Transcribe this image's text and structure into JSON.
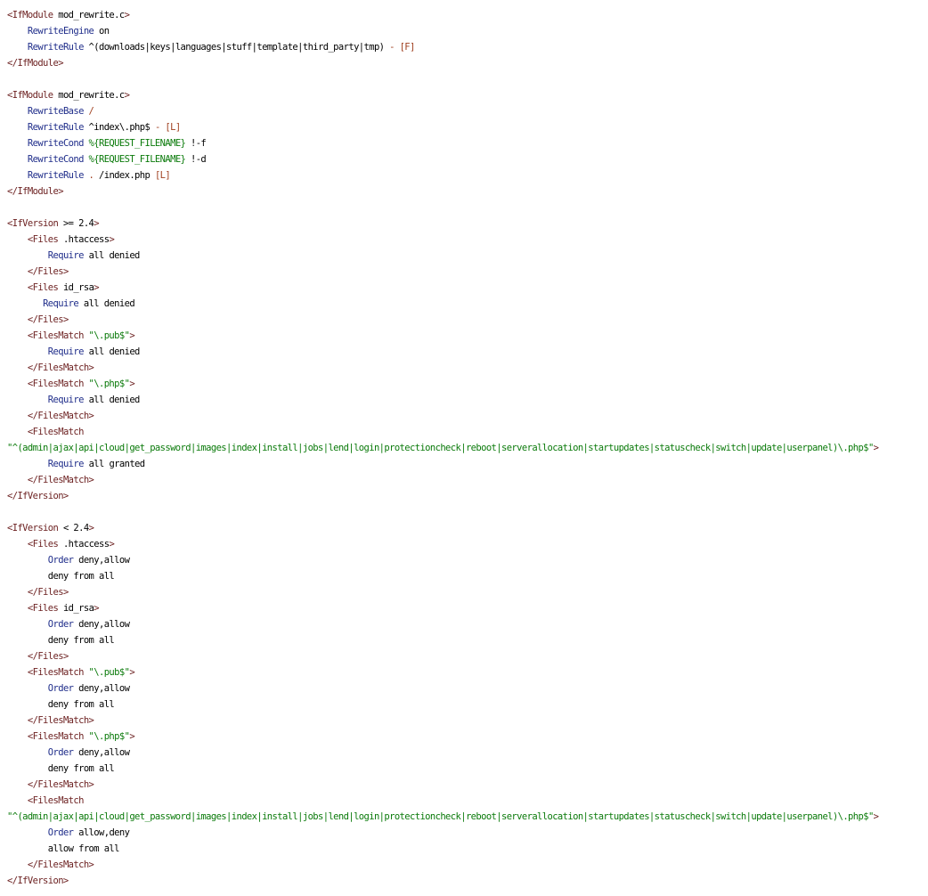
{
  "file": {
    "lines": [
      [
        {
          "c": "tag",
          "t": "<IfModule"
        },
        {
          "c": "txt",
          "t": " mod_rewrite.c"
        },
        {
          "c": "tag",
          "t": ">"
        }
      ],
      [
        {
          "c": "txt",
          "t": "    "
        },
        {
          "c": "kw",
          "t": "RewriteEngine"
        },
        {
          "c": "txt",
          "t": " on"
        }
      ],
      [
        {
          "c": "txt",
          "t": "    "
        },
        {
          "c": "kw",
          "t": "RewriteRule"
        },
        {
          "c": "txt",
          "t": " ^(downloads|keys|languages|stuff|template|third_party|tmp) "
        },
        {
          "c": "op",
          "t": "- [F]"
        }
      ],
      [
        {
          "c": "tag",
          "t": "</IfModule>"
        }
      ],
      [],
      [
        {
          "c": "tag",
          "t": "<IfModule"
        },
        {
          "c": "txt",
          "t": " mod_rewrite.c"
        },
        {
          "c": "tag",
          "t": ">"
        }
      ],
      [
        {
          "c": "txt",
          "t": "    "
        },
        {
          "c": "kw",
          "t": "RewriteBase"
        },
        {
          "c": "op",
          "t": " /"
        }
      ],
      [
        {
          "c": "txt",
          "t": "    "
        },
        {
          "c": "kw",
          "t": "RewriteRule"
        },
        {
          "c": "txt",
          "t": " ^index\\.php$ "
        },
        {
          "c": "op",
          "t": "- [L]"
        }
      ],
      [
        {
          "c": "txt",
          "t": "    "
        },
        {
          "c": "kw",
          "t": "RewriteCond"
        },
        {
          "c": "str",
          "t": " %{REQUEST_FILENAME}"
        },
        {
          "c": "txt",
          "t": " !-f"
        }
      ],
      [
        {
          "c": "txt",
          "t": "    "
        },
        {
          "c": "kw",
          "t": "RewriteCond"
        },
        {
          "c": "str",
          "t": " %{REQUEST_FILENAME}"
        },
        {
          "c": "txt",
          "t": " !-d"
        }
      ],
      [
        {
          "c": "txt",
          "t": "    "
        },
        {
          "c": "kw",
          "t": "RewriteRule"
        },
        {
          "c": "op",
          "t": " ."
        },
        {
          "c": "txt",
          "t": " /index.php "
        },
        {
          "c": "op",
          "t": "[L]"
        }
      ],
      [
        {
          "c": "tag",
          "t": "</IfModule>"
        }
      ],
      [],
      [
        {
          "c": "tag",
          "t": "<IfVersion"
        },
        {
          "c": "txt",
          "t": " >= 2.4"
        },
        {
          "c": "tag",
          "t": ">"
        }
      ],
      [
        {
          "c": "txt",
          "t": "    "
        },
        {
          "c": "tag",
          "t": "<Files"
        },
        {
          "c": "txt",
          "t": " .htaccess"
        },
        {
          "c": "tag",
          "t": ">"
        }
      ],
      [
        {
          "c": "txt",
          "t": "        "
        },
        {
          "c": "kw",
          "t": "Require"
        },
        {
          "c": "txt",
          "t": " all denied"
        }
      ],
      [
        {
          "c": "txt",
          "t": "    "
        },
        {
          "c": "tag",
          "t": "</Files>"
        }
      ],
      [
        {
          "c": "txt",
          "t": "    "
        },
        {
          "c": "tag",
          "t": "<Files"
        },
        {
          "c": "txt",
          "t": " id_rsa"
        },
        {
          "c": "tag",
          "t": ">"
        }
      ],
      [
        {
          "c": "txt",
          "t": "       "
        },
        {
          "c": "kw",
          "t": "Require"
        },
        {
          "c": "txt",
          "t": " all denied"
        }
      ],
      [
        {
          "c": "txt",
          "t": "    "
        },
        {
          "c": "tag",
          "t": "</Files>"
        }
      ],
      [
        {
          "c": "txt",
          "t": "    "
        },
        {
          "c": "tag",
          "t": "<FilesMatch"
        },
        {
          "c": "str",
          "t": " \"\\.pub$\""
        },
        {
          "c": "tag",
          "t": ">"
        }
      ],
      [
        {
          "c": "txt",
          "t": "        "
        },
        {
          "c": "kw",
          "t": "Require"
        },
        {
          "c": "txt",
          "t": " all denied"
        }
      ],
      [
        {
          "c": "txt",
          "t": "    "
        },
        {
          "c": "tag",
          "t": "</FilesMatch>"
        }
      ],
      [
        {
          "c": "txt",
          "t": "    "
        },
        {
          "c": "tag",
          "t": "<FilesMatch"
        },
        {
          "c": "str",
          "t": " \"\\.php$\""
        },
        {
          "c": "tag",
          "t": ">"
        }
      ],
      [
        {
          "c": "txt",
          "t": "        "
        },
        {
          "c": "kw",
          "t": "Require"
        },
        {
          "c": "txt",
          "t": " all denied"
        }
      ],
      [
        {
          "c": "txt",
          "t": "    "
        },
        {
          "c": "tag",
          "t": "</FilesMatch>"
        }
      ],
      [
        {
          "c": "txt",
          "t": "    "
        },
        {
          "c": "tag",
          "t": "<FilesMatch"
        }
      ],
      [
        {
          "c": "str",
          "t": "\"^(admin|ajax|api|cloud|get_password|images|index|install|jobs|lend|login|protectioncheck|reboot|serverallocation|startupdates|statuscheck|switch|update|userpanel)\\.php$\""
        },
        {
          "c": "tag",
          "t": ">"
        }
      ],
      [
        {
          "c": "txt",
          "t": "        "
        },
        {
          "c": "kw",
          "t": "Require"
        },
        {
          "c": "txt",
          "t": " all granted"
        }
      ],
      [
        {
          "c": "txt",
          "t": "    "
        },
        {
          "c": "tag",
          "t": "</FilesMatch>"
        }
      ],
      [
        {
          "c": "tag",
          "t": "</IfVersion>"
        }
      ],
      [],
      [
        {
          "c": "tag",
          "t": "<IfVersion"
        },
        {
          "c": "txt",
          "t": " < 2.4"
        },
        {
          "c": "tag",
          "t": ">"
        }
      ],
      [
        {
          "c": "txt",
          "t": "    "
        },
        {
          "c": "tag",
          "t": "<Files"
        },
        {
          "c": "txt",
          "t": " .htaccess"
        },
        {
          "c": "tag",
          "t": ">"
        }
      ],
      [
        {
          "c": "txt",
          "t": "        "
        },
        {
          "c": "kw",
          "t": "Order"
        },
        {
          "c": "txt",
          "t": " deny,allow"
        }
      ],
      [
        {
          "c": "txt",
          "t": "        deny from all"
        }
      ],
      [
        {
          "c": "txt",
          "t": "    "
        },
        {
          "c": "tag",
          "t": "</Files>"
        }
      ],
      [
        {
          "c": "txt",
          "t": "    "
        },
        {
          "c": "tag",
          "t": "<Files"
        },
        {
          "c": "txt",
          "t": " id_rsa"
        },
        {
          "c": "tag",
          "t": ">"
        }
      ],
      [
        {
          "c": "txt",
          "t": "        "
        },
        {
          "c": "kw",
          "t": "Order"
        },
        {
          "c": "txt",
          "t": " deny,allow"
        }
      ],
      [
        {
          "c": "txt",
          "t": "        deny from all"
        }
      ],
      [
        {
          "c": "txt",
          "t": "    "
        },
        {
          "c": "tag",
          "t": "</Files>"
        }
      ],
      [
        {
          "c": "txt",
          "t": "    "
        },
        {
          "c": "tag",
          "t": "<FilesMatch"
        },
        {
          "c": "str",
          "t": " \"\\.pub$\""
        },
        {
          "c": "tag",
          "t": ">"
        }
      ],
      [
        {
          "c": "txt",
          "t": "        "
        },
        {
          "c": "kw",
          "t": "Order"
        },
        {
          "c": "txt",
          "t": " deny,allow"
        }
      ],
      [
        {
          "c": "txt",
          "t": "        deny from all"
        }
      ],
      [
        {
          "c": "txt",
          "t": "    "
        },
        {
          "c": "tag",
          "t": "</FilesMatch>"
        }
      ],
      [
        {
          "c": "txt",
          "t": "    "
        },
        {
          "c": "tag",
          "t": "<FilesMatch"
        },
        {
          "c": "str",
          "t": " \"\\.php$\""
        },
        {
          "c": "tag",
          "t": ">"
        }
      ],
      [
        {
          "c": "txt",
          "t": "        "
        },
        {
          "c": "kw",
          "t": "Order"
        },
        {
          "c": "txt",
          "t": " deny,allow"
        }
      ],
      [
        {
          "c": "txt",
          "t": "        deny from all"
        }
      ],
      [
        {
          "c": "txt",
          "t": "    "
        },
        {
          "c": "tag",
          "t": "</FilesMatch>"
        }
      ],
      [
        {
          "c": "txt",
          "t": "    "
        },
        {
          "c": "tag",
          "t": "<FilesMatch"
        }
      ],
      [
        {
          "c": "str",
          "t": "\"^(admin|ajax|api|cloud|get_password|images|index|install|jobs|lend|login|protectioncheck|reboot|serverallocation|startupdates|statuscheck|switch|update|userpanel)\\.php$\""
        },
        {
          "c": "tag",
          "t": ">"
        }
      ],
      [
        {
          "c": "txt",
          "t": "        "
        },
        {
          "c": "kw",
          "t": "Order"
        },
        {
          "c": "txt",
          "t": " allow,deny"
        }
      ],
      [
        {
          "c": "txt",
          "t": "        allow from all"
        }
      ],
      [
        {
          "c": "txt",
          "t": "    "
        },
        {
          "c": "tag",
          "t": "</FilesMatch>"
        }
      ],
      [
        {
          "c": "tag",
          "t": "</IfVersion>"
        }
      ]
    ]
  },
  "colors": {
    "tag": "#6b1f1f",
    "keyword": "#1f2d8a",
    "string": "#0a7a0a",
    "text": "#000000",
    "operator": "#a04020",
    "background": "#ffffff"
  }
}
